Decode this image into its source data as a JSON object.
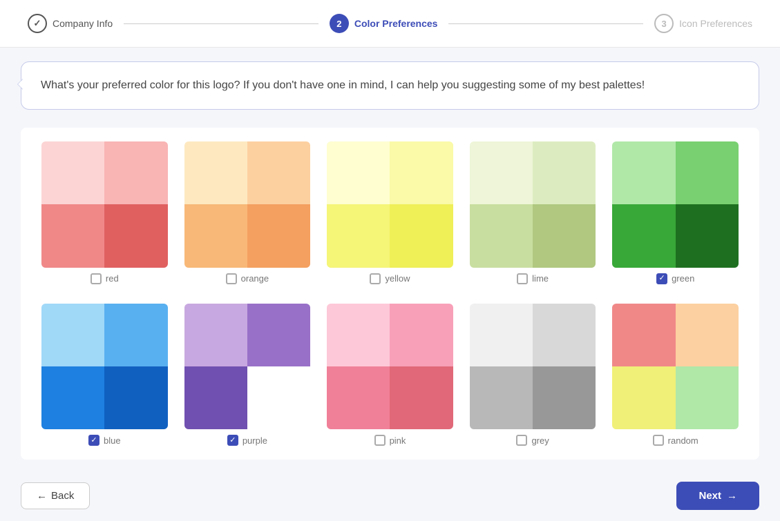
{
  "stepper": {
    "step1": {
      "label": "Company Info",
      "state": "done",
      "number": "✓"
    },
    "step2": {
      "label": "Color Preferences",
      "state": "active",
      "number": "2"
    },
    "step3": {
      "label": "Icon Preferences",
      "state": "inactive",
      "number": "3"
    }
  },
  "chat": {
    "message": "What's your preferred color for this logo? If you don't have one in mind, I can help you suggesting some of my best palettes!"
  },
  "colors": [
    {
      "id": "red",
      "label": "red",
      "checked": false,
      "cells": [
        "#f9c8c8",
        "#f5a8a8",
        "#f08080",
        "#e06060"
      ]
    },
    {
      "id": "orange",
      "label": "orange",
      "checked": false,
      "cells": [
        "#fde4be",
        "#fcd09e",
        "#f8b878",
        "#f4a060"
      ]
    },
    {
      "id": "yellow",
      "label": "yellow",
      "checked": false,
      "cells": [
        "#fdfdc8",
        "#fafaa0",
        "#f5f578",
        "#f0f060"
      ]
    },
    {
      "id": "lime",
      "label": "lime",
      "checked": false,
      "cells": [
        "#eef5d8",
        "#ddecc0",
        "#c8dea0",
        "#b0c888"
      ]
    },
    {
      "id": "green",
      "label": "green",
      "checked": true,
      "cells": [
        "#a8e0a0",
        "#70c870",
        "#38a838",
        "#208020"
      ]
    },
    {
      "id": "blue",
      "label": "blue",
      "checked": true,
      "cells": [
        "#90d0f8",
        "#50a8f0",
        "#2080e0",
        "#1060c0"
      ]
    },
    {
      "id": "purple",
      "label": "purple",
      "checked": true,
      "cells": [
        "#c8a8e0",
        "#9878c8",
        "#7050b0",
        "#4830908"
      ]
    },
    {
      "id": "pink",
      "label": "pink",
      "checked": false,
      "cells": [
        "#fdc8d8",
        "#f8a0b8",
        "#f08098",
        "#e06878"
      ]
    },
    {
      "id": "grey",
      "label": "grey",
      "checked": false,
      "cells": [
        "#f0f0f0",
        "#d8d8d8",
        "#b8b8b8",
        "#989898"
      ]
    },
    {
      "id": "random",
      "label": "random",
      "checked": false,
      "cells": [
        "#f08080",
        "#fcd09e",
        "#fafaa0",
        "#a8e0a0",
        "#c8e8a0",
        "#c8a8e0",
        "#f8a0b8",
        "#90d0f8"
      ]
    }
  ],
  "buttons": {
    "back": "Back",
    "next": "Next"
  }
}
